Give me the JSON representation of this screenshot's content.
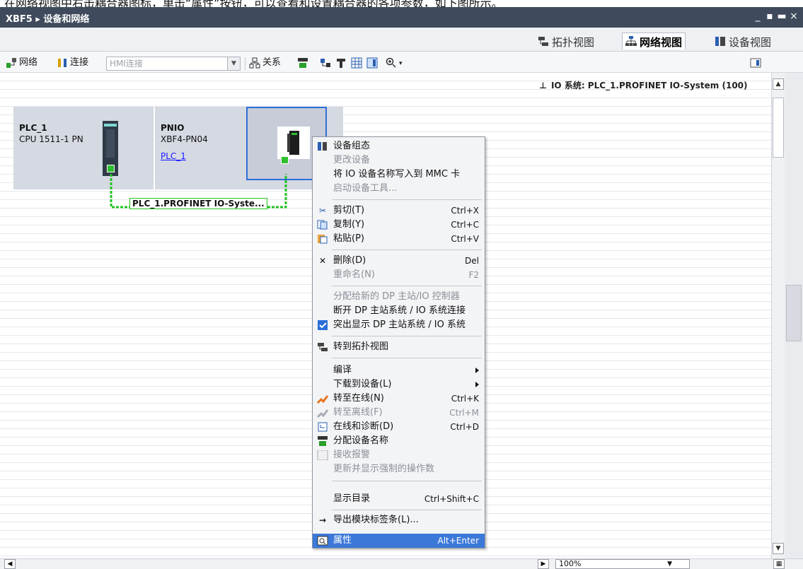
{
  "caption": "在网络视图中右击耦合器图标，单击“属性”按钮，可以查看和设置耦合器的各项参数，如下图所示。",
  "window": {
    "title": "XBF5 ▸ 设备和网络",
    "controls": [
      "_",
      "▪",
      "▬",
      "×"
    ]
  },
  "view_tabs": [
    {
      "label": "拓扑视图",
      "icon": "topology-icon",
      "active": false
    },
    {
      "label": "网络视图",
      "icon": "network-view-icon",
      "active": true
    },
    {
      "label": "设备视图",
      "icon": "device-view-icon",
      "active": false
    }
  ],
  "toolbar": {
    "network_label": "网络",
    "connection_label": "连接",
    "hmi_select": "HMI连接",
    "relation_label": "关系"
  },
  "canvas": {
    "io_system_label": "IO 系统: PLC_1.PROFINET IO-System (100)",
    "devices": [
      {
        "name": "PLC_1",
        "type": "CPU 1511-1 PN",
        "link": ""
      },
      {
        "name": "PNIO",
        "type": "XBF4-PN04",
        "link": "PLC_1"
      }
    ],
    "network_label": "PLC_1.PROFINET IO-Syste..."
  },
  "zoom": "100%",
  "context_menu": [
    {
      "label": "设备组态",
      "shortcut": "",
      "icon": "device-config-icon",
      "disabled": false
    },
    {
      "label": "更改设备",
      "shortcut": "",
      "icon": "",
      "disabled": true
    },
    {
      "label": "将 IO 设备名称写入到 MMC 卡",
      "shortcut": "",
      "icon": "",
      "disabled": false
    },
    {
      "label": "启动设备工具...",
      "shortcut": "",
      "icon": "",
      "disabled": true
    },
    {
      "label": "剪切(T)",
      "shortcut": "Ctrl+X",
      "icon": "scissors-icon",
      "disabled": false
    },
    {
      "label": "复制(Y)",
      "shortcut": "Ctrl+C",
      "icon": "copy-icon",
      "disabled": false
    },
    {
      "label": "粘贴(P)",
      "shortcut": "Ctrl+V",
      "icon": "paste-icon",
      "disabled": false
    },
    {
      "label": "删除(D)",
      "shortcut": "Del",
      "icon": "delete-icon",
      "disabled": false
    },
    {
      "label": "重命名(N)",
      "shortcut": "F2",
      "icon": "",
      "disabled": true
    },
    {
      "label": "分配给新的 DP 主站/IO 控制器",
      "shortcut": "",
      "icon": "",
      "disabled": true
    },
    {
      "label": "断开 DP 主站系统 / IO 系统连接",
      "shortcut": "",
      "icon": "",
      "disabled": false
    },
    {
      "label": "突出显示 DP 主站系统 / IO 系统",
      "shortcut": "",
      "icon": "checkbox-checked-icon",
      "disabled": false
    },
    {
      "label": "转到拓扑视图",
      "shortcut": "",
      "icon": "topology-icon",
      "disabled": false
    },
    {
      "label": "编译",
      "shortcut": "",
      "icon": "",
      "disabled": false,
      "submenu": true
    },
    {
      "label": "下载到设备(L)",
      "shortcut": "",
      "icon": "",
      "disabled": false,
      "submenu": true
    },
    {
      "label": "转至在线(N)",
      "shortcut": "Ctrl+K",
      "icon": "go-online-icon",
      "disabled": false
    },
    {
      "label": "转至离线(F)",
      "shortcut": "Ctrl+M",
      "icon": "go-offline-icon",
      "disabled": true
    },
    {
      "label": "在线和诊断(D)",
      "shortcut": "Ctrl+D",
      "icon": "diagnostics-icon",
      "disabled": false
    },
    {
      "label": "分配设备名称",
      "shortcut": "",
      "icon": "assign-name-icon",
      "disabled": false
    },
    {
      "label": "接收报警",
      "shortcut": "",
      "icon": "checkbox-icon",
      "disabled": true
    },
    {
      "label": "更新并显示强制的操作数",
      "shortcut": "",
      "icon": "",
      "disabled": true
    },
    {
      "label": "显示目录",
      "shortcut": "Ctrl+Shift+C",
      "icon": "",
      "disabled": false
    },
    {
      "label": "导出模块标签条(L)...",
      "shortcut": "",
      "icon": "export-icon",
      "disabled": false
    },
    {
      "label": "属性",
      "shortcut": "Alt+Enter",
      "icon": "properties-icon",
      "disabled": false,
      "highlighted": true
    }
  ],
  "colors": {
    "titlebar": "#3f4a5c",
    "highlight": "#3b78d8",
    "network": "#21c421"
  }
}
